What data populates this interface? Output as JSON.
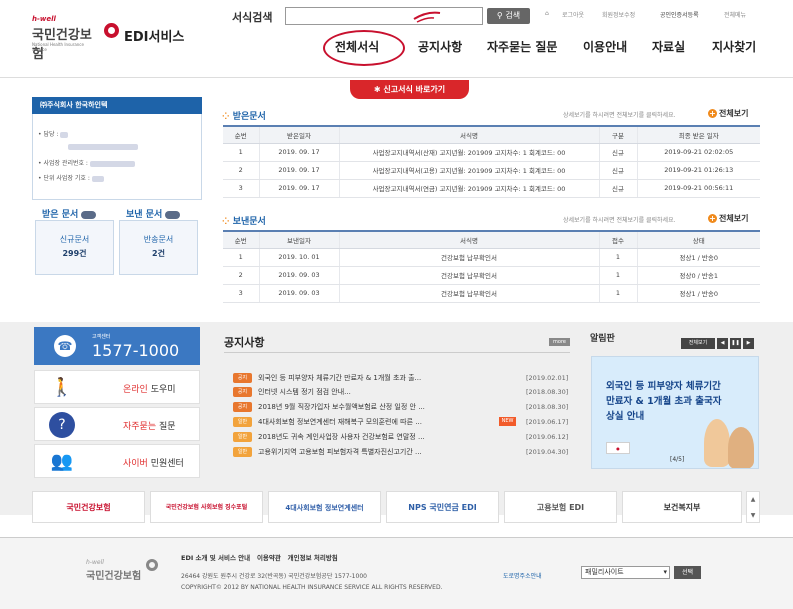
{
  "brand": {
    "hwell": "h-well",
    "name": "국민건강보험",
    "en": "National Health Insurance Service",
    "service": "EDI서비스"
  },
  "search": {
    "label": "서식검색",
    "placeholder": "",
    "button": "검색"
  },
  "util_links": [
    "로그아웃",
    "회원정보수정",
    "공인인증서등록",
    "전체메뉴"
  ],
  "nav": [
    "전체서식",
    "공지사항",
    "자주묻는 질문",
    "이용안내",
    "자료실",
    "지사찾기"
  ],
  "report_button": "신고서식 바로가기",
  "company": {
    "title": "㈜주식회사 한국하인텍",
    "rows": [
      "담당 :",
      "사업장 관리번호 :",
      "단위 사업장 기호 :"
    ]
  },
  "docs": {
    "received_label": "받은 문서",
    "sent_label": "보낸 문서",
    "new_label": "신규문서",
    "new_count": "299건",
    "returned_label": "반송문서",
    "returned_count": "2건"
  },
  "received": {
    "title": "받은문서",
    "note": "상세보기를 하시려면 전체보기를 클릭하세요.",
    "fullview": "전체보기",
    "headers": [
      "순번",
      "받은일자",
      "서식명",
      "구분",
      "최종 받은 일자"
    ],
    "rows": [
      [
        "1",
        "2019. 09. 17",
        "사업장고지내역서(산재) 고지년월: 201909 고지차수: 1 회계코드: 00",
        "신규",
        "2019-09-21 02:02:05"
      ],
      [
        "2",
        "2019. 09. 17",
        "사업장고지내역서(고용) 고지년월: 201909 고지차수: 1 회계코드: 00",
        "신규",
        "2019-09-21 01:26:13"
      ],
      [
        "3",
        "2019. 09. 17",
        "사업장고지내역서(연금) 고지년월: 201909 고지차수: 1 회계코드: 00",
        "신규",
        "2019-09-21 00:56:11"
      ]
    ]
  },
  "sent": {
    "title": "보낸문서",
    "note": "상세보기를 하시려면 전체보기를 클릭하세요.",
    "fullview": "전체보기",
    "headers": [
      "순번",
      "보낸일자",
      "서식명",
      "접수",
      "상태"
    ],
    "rows": [
      [
        "1",
        "2019. 10. 01",
        "건강보험 납부확인서",
        "1",
        "정상1 / 반송0"
      ],
      [
        "2",
        "2019. 09. 03",
        "건강보험 납부확인서",
        "1",
        "정상0 / 반송1"
      ],
      [
        "3",
        "2019. 09. 03",
        "건강보험 납부확인서",
        "1",
        "정상1 / 반송0"
      ]
    ]
  },
  "callcenter": {
    "label": "고객센터",
    "number": "1577-1000"
  },
  "services": [
    {
      "hl": "온라인",
      "rest": " 도우미"
    },
    {
      "hl": "자주묻는",
      "rest": " 질문"
    },
    {
      "hl": "사이버",
      "rest": " 민원센터"
    }
  ],
  "notices": {
    "title": "공지사항",
    "more": "more",
    "items": [
      {
        "tag": "공지",
        "title": "외국인 등 피부양자 체류기간 만료자 & 1개월 초과 출...",
        "date": "[2019.02.01]"
      },
      {
        "tag": "공지",
        "title": "인터넷 시스템 정기 점검 안내...",
        "date": "[2018.08.30]"
      },
      {
        "tag": "공지",
        "title": "2018년 9월 직장가입자 보수월액보험료 산정 일정 안 ...",
        "date": "[2018.08.30]"
      },
      {
        "tag": "일반",
        "title": "4대사회보험 정보연계센터 재해복구 모의훈련에 따른 ...",
        "date": "[2019.06.17]",
        "new": "NEW"
      },
      {
        "tag": "일반",
        "title": "2018년도 귀속 계인사업장 사용자 건강보험료 연말정 ...",
        "date": "[2019.06.12]"
      },
      {
        "tag": "일반",
        "title": "고용위기지역 고용보험 피보험자격 특별자진신고기간 ...",
        "date": "[2019.04.30]"
      }
    ]
  },
  "alarm": {
    "title": "알림판",
    "fullview": "전체보기",
    "banner_lines": [
      "외국인 등 피부양자 체류기간",
      "만료자 & 1개월 초과 출국자",
      "상실 안내"
    ],
    "page": "[4/5]"
  },
  "partners": [
    "국민건강보험",
    "국민건강보험 사회보험 징수포털",
    "4대사회보험 정보연계센터",
    "NPS 국민연금 EDI",
    "고용보험 EDI",
    "보건복지부"
  ],
  "footer": {
    "links": [
      "EDI 소개 및 서비스 안내",
      "이용약관",
      "개인정보 처리방침"
    ],
    "address": "26464  강원도 원주시 건강로 32(반곡동)  국민건강보험공단 1577-1000",
    "road": "도로명주소안내",
    "copyright": "COPYRIGHT© 2012 BY NATIONAL HEALTH INSURANCE SERVICE ALL RIGHTS RESERVED.",
    "family": "패밀리사이트",
    "go": "선택"
  },
  "colors": {
    "brand_red": "#c8102e",
    "blue": "#1e63a9",
    "callcenter": "#3b78c2",
    "notice_orange": "#f08a1c"
  }
}
